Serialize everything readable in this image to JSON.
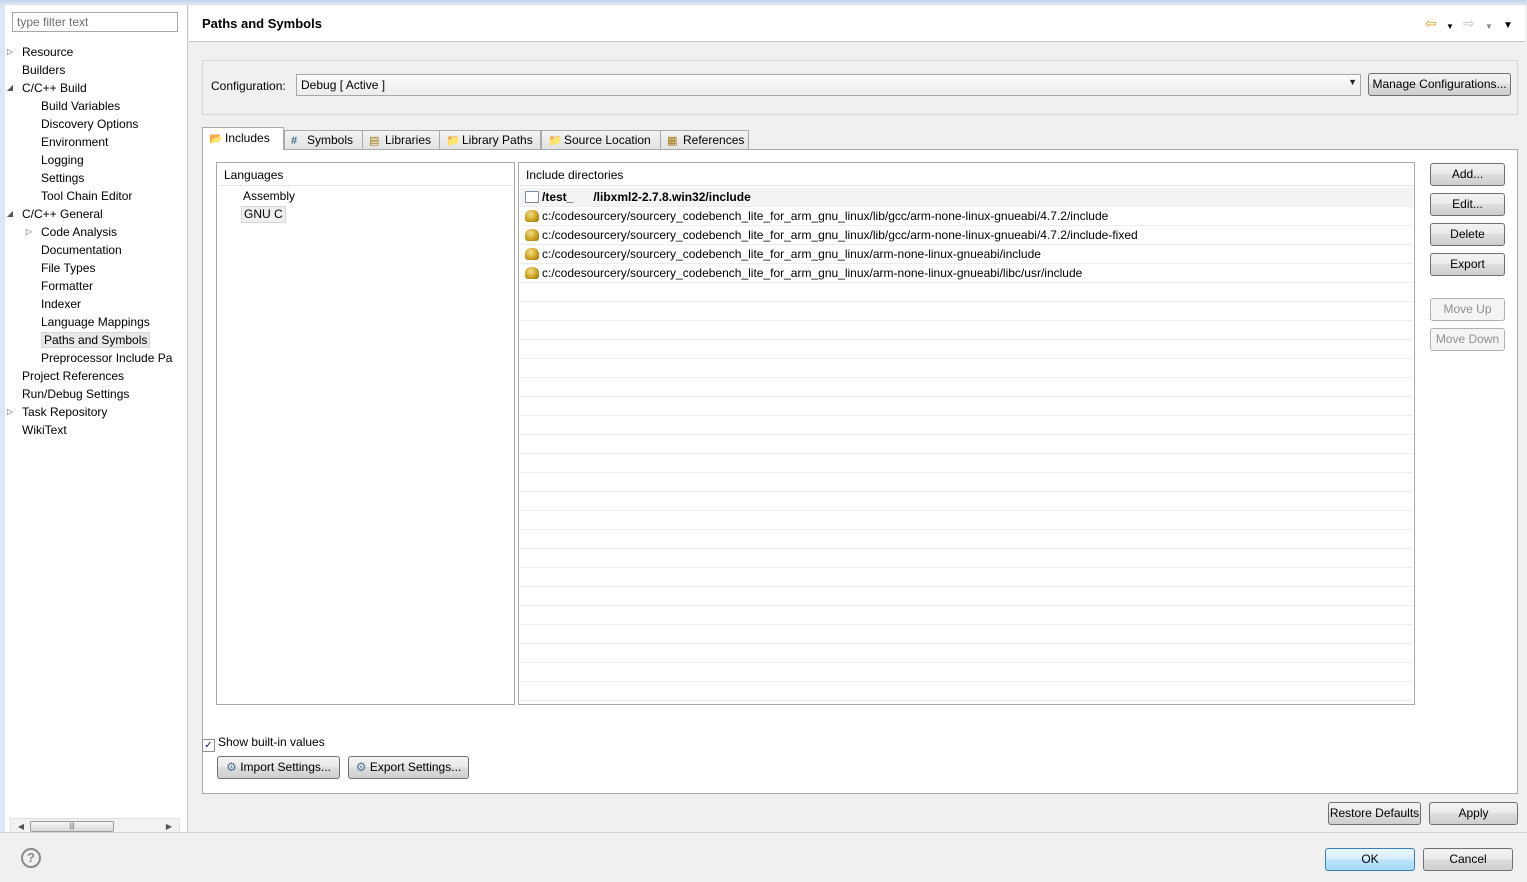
{
  "filter": {
    "placeholder": "type filter text"
  },
  "tree": [
    {
      "label": "Resource",
      "twisty": "closed",
      "depth": 0
    },
    {
      "label": "Builders",
      "twisty": "none",
      "depth": 0
    },
    {
      "label": "C/C++ Build",
      "twisty": "open",
      "depth": 0
    },
    {
      "label": "Build Variables",
      "twisty": "none",
      "depth": 1
    },
    {
      "label": "Discovery Options",
      "twisty": "none",
      "depth": 1
    },
    {
      "label": "Environment",
      "twisty": "none",
      "depth": 1
    },
    {
      "label": "Logging",
      "twisty": "none",
      "depth": 1
    },
    {
      "label": "Settings",
      "twisty": "none",
      "depth": 1
    },
    {
      "label": "Tool Chain Editor",
      "twisty": "none",
      "depth": 1
    },
    {
      "label": "C/C++ General",
      "twisty": "open",
      "depth": 0
    },
    {
      "label": "Code Analysis",
      "twisty": "closed",
      "depth": 1
    },
    {
      "label": "Documentation",
      "twisty": "none",
      "depth": 1
    },
    {
      "label": "File Types",
      "twisty": "none",
      "depth": 1
    },
    {
      "label": "Formatter",
      "twisty": "none",
      "depth": 1
    },
    {
      "label": "Indexer",
      "twisty": "none",
      "depth": 1
    },
    {
      "label": "Language Mappings",
      "twisty": "none",
      "depth": 1
    },
    {
      "label": "Paths and Symbols",
      "twisty": "none",
      "depth": 1,
      "selected": true
    },
    {
      "label": "Preprocessor Include Pa",
      "twisty": "none",
      "depth": 1
    },
    {
      "label": "Project References",
      "twisty": "none",
      "depth": 0
    },
    {
      "label": "Run/Debug Settings",
      "twisty": "none",
      "depth": 0
    },
    {
      "label": "Task Repository",
      "twisty": "closed",
      "depth": 0
    },
    {
      "label": "WikiText",
      "twisty": "none",
      "depth": 0
    }
  ],
  "header": {
    "title": "Paths and Symbols"
  },
  "config": {
    "label": "Configuration:",
    "value": "Debug  [ Active ]",
    "manage_label": "Manage Configurations..."
  },
  "tabs": [
    {
      "label": "Includes",
      "icon": "includes-icon",
      "active": true
    },
    {
      "label": "Symbols",
      "icon": "hash-icon",
      "active": false
    },
    {
      "label": "Libraries",
      "icon": "libraries-icon",
      "active": false
    },
    {
      "label": "Library Paths",
      "icon": "folder-icon",
      "active": false
    },
    {
      "label": "Source Location",
      "icon": "source-folder-icon",
      "active": false
    },
    {
      "label": "References",
      "icon": "references-icon",
      "active": false
    }
  ],
  "languages": {
    "header": "Languages",
    "items": [
      {
        "label": "Assembly",
        "selected": false
      },
      {
        "label": "GNU C",
        "selected": true
      }
    ]
  },
  "includes": {
    "header": "Include directories",
    "rows": [
      {
        "path": "/test_      /libxml2-2.7.8.win32/include",
        "kind": "project"
      },
      {
        "path": "c:/codesourcery/sourcery_codebench_lite_for_arm_gnu_linux/lib/gcc/arm-none-linux-gnueabi/4.7.2/include",
        "kind": "builtin"
      },
      {
        "path": "c:/codesourcery/sourcery_codebench_lite_for_arm_gnu_linux/lib/gcc/arm-none-linux-gnueabi/4.7.2/include-fixed",
        "kind": "builtin"
      },
      {
        "path": "c:/codesourcery/sourcery_codebench_lite_for_arm_gnu_linux/arm-none-linux-gnueabi/include",
        "kind": "builtin"
      },
      {
        "path": "c:/codesourcery/sourcery_codebench_lite_for_arm_gnu_linux/arm-none-linux-gnueabi/libc/usr/include",
        "kind": "builtin"
      }
    ]
  },
  "side_buttons": {
    "add": "Add...",
    "edit": "Edit...",
    "delete": "Delete",
    "export": "Export",
    "move_up": "Move Up",
    "move_down": "Move Down"
  },
  "show_builtin": {
    "label": "Show built-in values",
    "checked": true
  },
  "import_settings": "Import Settings...",
  "export_settings": "Export Settings...",
  "restore_defaults": "Restore Defaults",
  "apply": "Apply",
  "ok": "OK",
  "cancel": "Cancel",
  "help": "?"
}
